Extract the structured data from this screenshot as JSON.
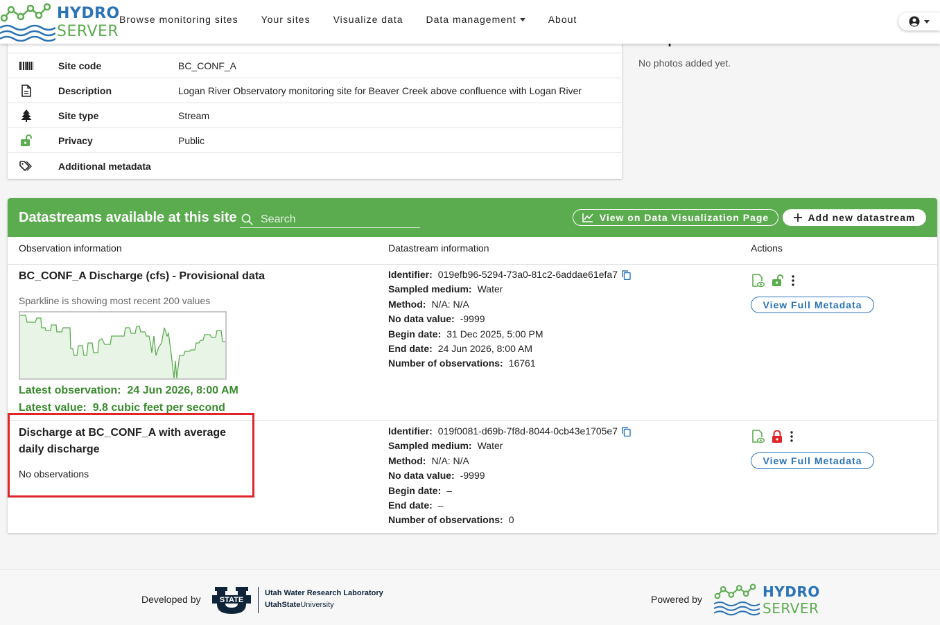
{
  "header": {
    "logo": {
      "line1": "HYDRO",
      "line2": "SERVER"
    },
    "nav": [
      {
        "label": "Browse monitoring sites"
      },
      {
        "label": "Your sites"
      },
      {
        "label": "Visualize data"
      },
      {
        "label": "Data management"
      },
      {
        "label": "About"
      }
    ]
  },
  "site_details": {
    "rows": [
      {
        "label": "Site code",
        "value": "BC_CONF_A",
        "icon": "barcode-icon"
      },
      {
        "label": "Description",
        "value": "Logan River Observatory monitoring site for Beaver Creek above confluence with Logan River",
        "icon": "document-icon"
      },
      {
        "label": "Site type",
        "value": "Stream",
        "icon": "tree-icon"
      },
      {
        "label": "Privacy",
        "value": "Public",
        "icon": "unlock-icon"
      },
      {
        "label": "Additional metadata",
        "value": "",
        "icon": "tag-icon"
      }
    ]
  },
  "photos": {
    "title": "Site photos",
    "empty_text": "No photos added yet."
  },
  "datastreams": {
    "title": "Datastreams available at this site",
    "search_placeholder": "Search",
    "view_viz_label": "View on Data Visualization Page",
    "add_label": "Add new datastream",
    "columns": {
      "observation": "Observation information",
      "datastream": "Datastream information",
      "actions": "Actions"
    },
    "items": [
      {
        "title": "BC_CONF_A Discharge (cfs) - Provisional data",
        "sparkline_note": "Sparkline is showing most recent 200 values",
        "latest_observation_label": "Latest observation:",
        "latest_observation": "24 Jun 2026, 8:00 AM",
        "latest_value_label": "Latest value:",
        "latest_value": "9.8 cubic feet per second",
        "identifier": "019efb96-5294-73a0-81c2-6addae61efa7",
        "sampled_medium": "Water",
        "method": "N/A: N/A",
        "no_data_value": "-9999",
        "begin_date": "31 Dec 2025, 5:00 PM",
        "end_date": "24 Jun 2026, 8:00 AM",
        "num_observations": "16761",
        "privacy": "public",
        "meta_button": "View Full Metadata"
      },
      {
        "title": "Discharge at BC_CONF_A with average daily discharge",
        "no_obs_text": "No observations",
        "identifier": "019f0081-d69b-7f8d-8044-0cb43e1705e7",
        "sampled_medium": "Water",
        "method": "N/A: N/A",
        "no_data_value": "-9999",
        "begin_date": "–",
        "end_date": "–",
        "num_observations": "0",
        "privacy": "private",
        "meta_button": "View Full Metadata"
      }
    ],
    "labels": {
      "identifier": "Identifier:",
      "sampled_medium": "Sampled medium:",
      "method": "Method:",
      "no_data_value": "No data value:",
      "begin_date": "Begin date:",
      "end_date": "End date:",
      "num_observations": "Number of observations:"
    }
  },
  "footer": {
    "developed_by": "Developed by",
    "usu_lab": "Utah Water Research Laboratory",
    "usu_name_bold": "UtahState",
    "usu_name_rest": "University",
    "usu_logo_text": "STATE",
    "powered_by": "Powered by"
  },
  "colors": {
    "green": "#5bac4f",
    "blue": "#2a73b6",
    "red": "#e0242a"
  }
}
